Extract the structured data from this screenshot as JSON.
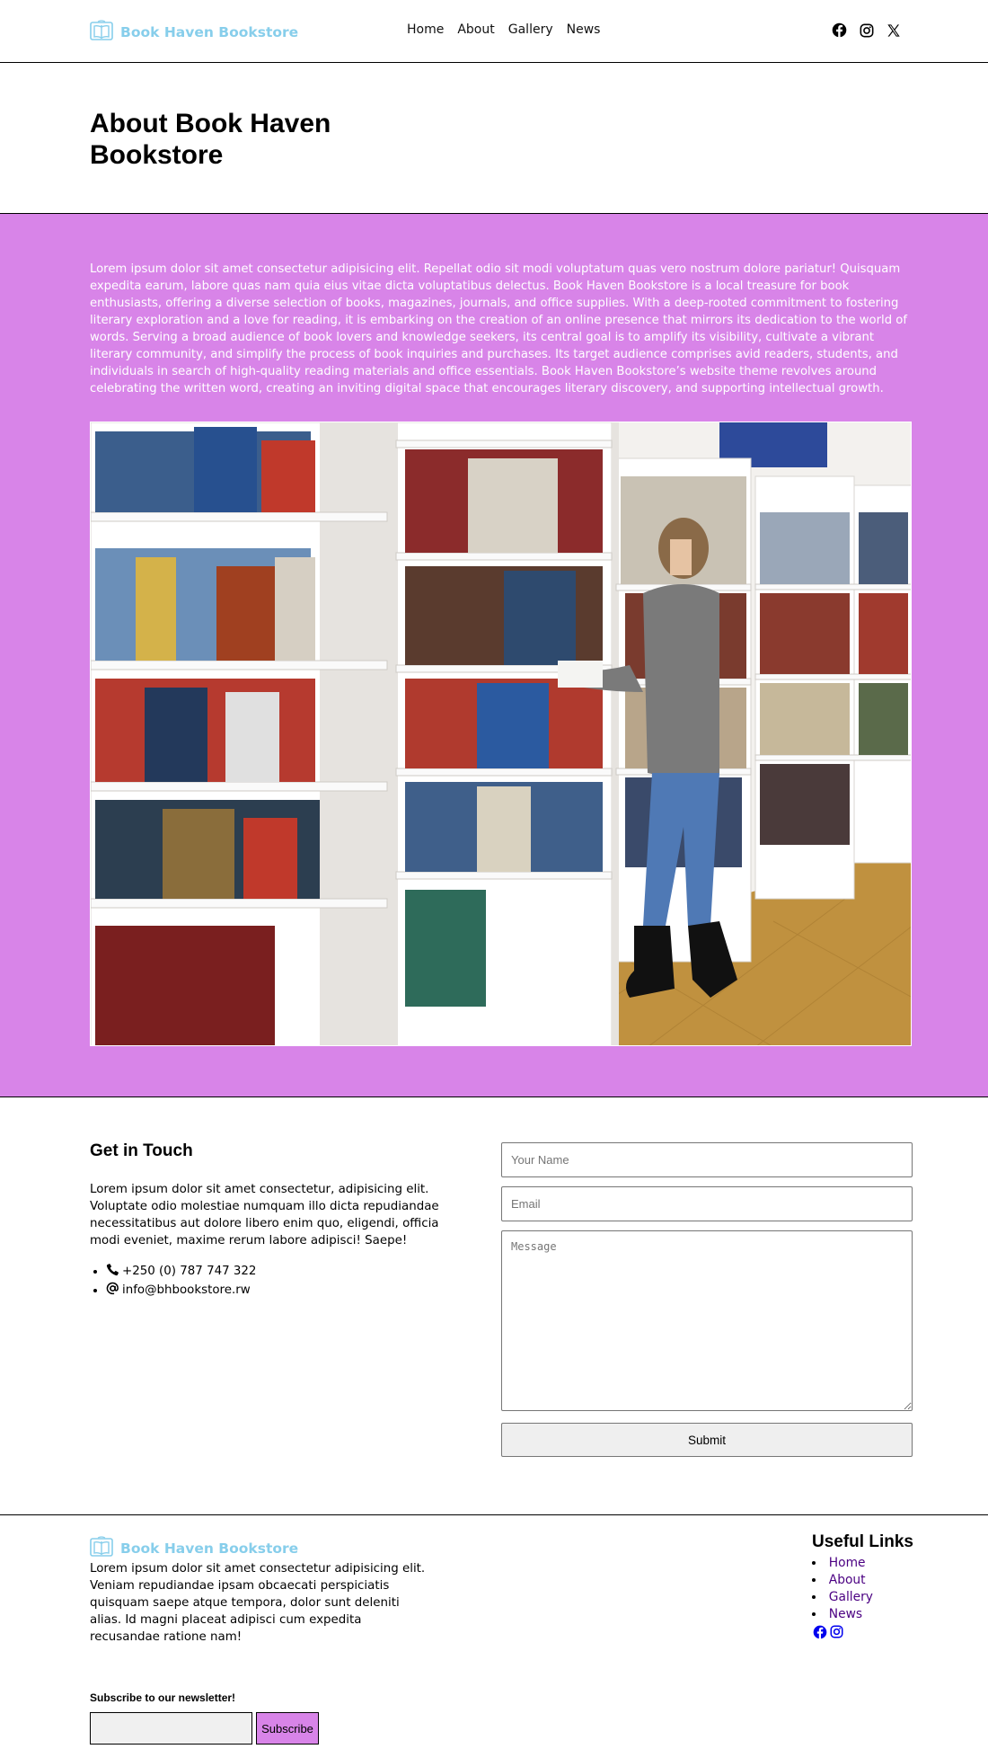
{
  "header": {
    "brand": "Book Haven Bookstore",
    "nav": [
      "Home",
      "About",
      "Gallery",
      "News"
    ],
    "social_icons": [
      "facebook-icon",
      "instagram-icon",
      "x-icon"
    ]
  },
  "page": {
    "title": "About Book Haven Bookstore"
  },
  "about": {
    "text": "Lorem ipsum dolor sit amet consectetur adipisicing elit. Repellat odio sit modi voluptatum quas vero nostrum dolore pariatur! Quisquam expedita earum, labore quas nam quia eius vitae dicta voluptatibus delectus. Book Haven Bookstore is a local treasure for book enthusiasts, offering a diverse selection of books, magazines, journals, and office supplies. With a deep-rooted commitment to fostering literary exploration and a love for reading, it is embarking on the creation of an online presence that mirrors its dedication to the world of words. Serving a broad audience of book lovers and knowledge seekers, its central goal is to amplify its visibility, cultivate a vibrant literary community, and simplify the process of book inquiries and purchases. Its target audience comprises avid readers, students, and individuals in search of high-quality reading materials and office essentials. Book Haven Bookstore’s website theme revolves around celebrating the written word, creating an inviting digital space that encourages literary discovery, and supporting intellectual growth.",
    "accent_color": "#d884e8"
  },
  "contact": {
    "title": "Get in Touch",
    "description": "Lorem ipsum dolor sit amet consectetur, adipisicing elit. Voluptate odio molestiae numquam illo dicta repudiandae necessitatibus aut dolore libero enim quo, eligendi, officia modi eveniet, maxime rerum labore adipisci! Saepe!",
    "phone": "+250 (0) 787 747 322",
    "email": "info@bhbookstore.rw",
    "form": {
      "name_placeholder": "Your Name",
      "email_placeholder": "Email",
      "message_placeholder": "Message",
      "submit_label": "Submit"
    }
  },
  "footer": {
    "brand": "Book Haven Bookstore",
    "description": "Lorem ipsum dolor sit amet consectetur adipisicing elit. Veniam repudiandae ipsam obcaecati perspiciatis quisquam saepe atque tempora, dolor sunt deleniti alias. Id magni placeat adipisci cum expedita recusandae ratione nam!",
    "useful_links_title": "Useful Links",
    "links": [
      "Home",
      "About",
      "Gallery",
      "News"
    ],
    "newsletter_label": "Subscribe to our newsletter!",
    "subscribe_label": "Subscribe"
  }
}
